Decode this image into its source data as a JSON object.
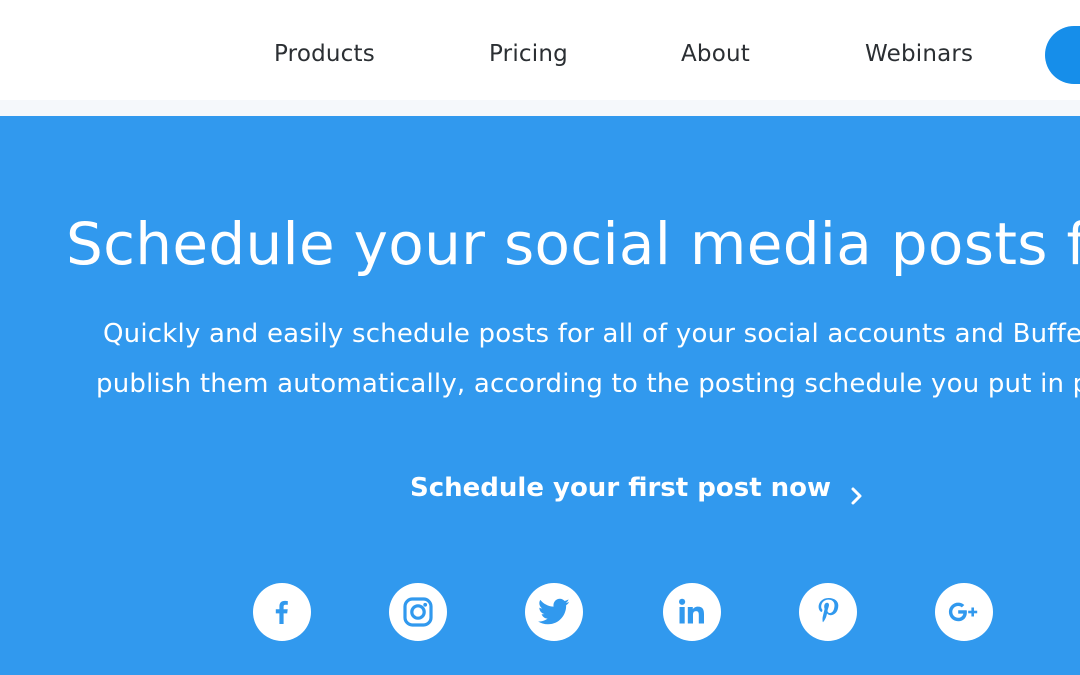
{
  "nav": {
    "items": [
      {
        "label": "Products"
      },
      {
        "label": "Pricing"
      },
      {
        "label": "About"
      },
      {
        "label": "Webinars"
      }
    ]
  },
  "hero": {
    "title": "Schedule your social media posts for la",
    "subtitle_line1": "Quickly and easily schedule posts for all of your social accounts and Buffe",
    "subtitle_line2": "publish them automatically, according to the posting schedule you put in p",
    "cta_label": "Schedule your first post now"
  },
  "social_icons": [
    "facebook-icon",
    "instagram-icon",
    "twitter-icon",
    "linkedin-icon",
    "pinterest-icon",
    "google-plus-icon"
  ],
  "colors": {
    "hero_background": "#3199ee",
    "brand_blue": "#168eea",
    "nav_text": "#2b2f33",
    "white": "#ffffff"
  }
}
